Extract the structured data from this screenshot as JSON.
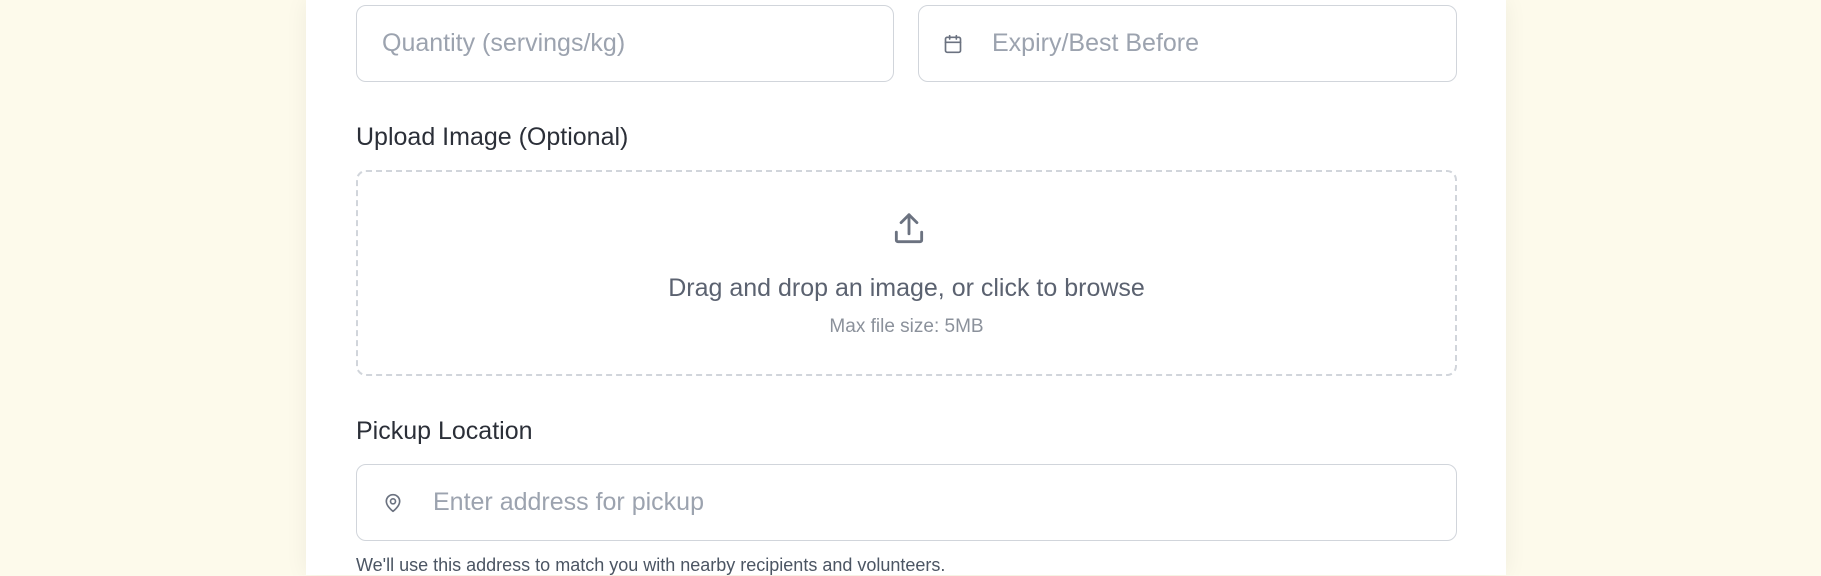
{
  "form": {
    "quantity": {
      "placeholder": "Quantity (servings/kg)",
      "value": ""
    },
    "expiry": {
      "placeholder": "Expiry/Best Before",
      "value": "",
      "icon": "calendar-icon"
    },
    "upload": {
      "label": "Upload Image (Optional)",
      "icon": "upload-icon",
      "prompt": "Drag and drop an image, or click to browse",
      "max_size": "Max file size: 5MB"
    },
    "pickup": {
      "label": "Pickup Location",
      "placeholder": "Enter address for pickup",
      "value": "",
      "icon": "map-pin-icon",
      "hint": "We'll use this address to match you with nearby recipients and volunteers."
    }
  },
  "colors": {
    "page_background": "#fdfaeb",
    "card_background": "#ffffff",
    "border": "#d1d5db",
    "placeholder": "#9ca3af",
    "label": "#2b2f38",
    "icon": "#6b7280"
  }
}
